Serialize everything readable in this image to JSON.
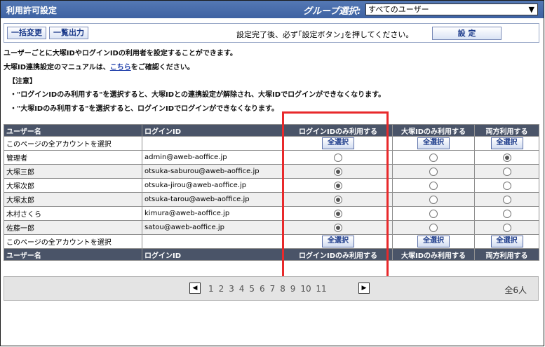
{
  "titlebar": {
    "title": "利用許可設定",
    "group_label": "グループ選択:",
    "group_value": "すべてのユーザー"
  },
  "toolbar": {
    "bulk_change": "一括変更",
    "list_output": "一覧出力",
    "notice": "設定完了後、必ず｢設定ボタン｣を押してください。",
    "set_button": "設 定"
  },
  "info": {
    "line1": "ユーザーごとに大塚IDやログインIDの利用者を設定することができます。",
    "line2_pre": "大塚ID連携設定のマニュアルは、",
    "line2_link": "こちら",
    "line2_post": "をご確認ください。",
    "caution": "【注意】",
    "note1": "・\"ログインIDのみ利用する\"を選択すると、大塚IDとの連携設定が解除され、大塚IDでログインができなくなります。",
    "note2": "・\"大塚IDのみ利用する\"を選択すると、ログインIDでログインができなくなります。"
  },
  "table": {
    "headers": [
      "ユーザー名",
      "ログインID",
      "ログインIDのみ利用する",
      "大塚IDのみ利用する",
      "両方利用する"
    ],
    "select_all_row_label": "このページの全アカウントを選択",
    "select_all_button": "全選択",
    "rows": [
      {
        "name": "管理者",
        "login": "admin@aweb-aoffice.jp",
        "selected": 2
      },
      {
        "name": "大塚三郎",
        "login": "otsuka-saburou@aweb-aoffice.jp",
        "selected": 0
      },
      {
        "name": "大塚次郎",
        "login": "otsuka-jirou@aweb-aoffice.jp",
        "selected": 0
      },
      {
        "name": "大塚太郎",
        "login": "otsuka-tarou@aweb-aoffice.jp",
        "selected": 0
      },
      {
        "name": "木村さくら",
        "login": "kimura@aweb-aoffice.jp",
        "selected": 0
      },
      {
        "name": "佐藤一郎",
        "login": "satou@aweb-aoffice.jp",
        "selected": 0
      }
    ]
  },
  "pager": {
    "pages": [
      "1",
      "2",
      "3",
      "4",
      "5",
      "6",
      "7",
      "8",
      "9",
      "10",
      "11"
    ],
    "total": "全6人"
  },
  "colors": {
    "header_bar": "#3e62a2",
    "table_header": "#4a5468",
    "highlight": "#e8292b"
  }
}
